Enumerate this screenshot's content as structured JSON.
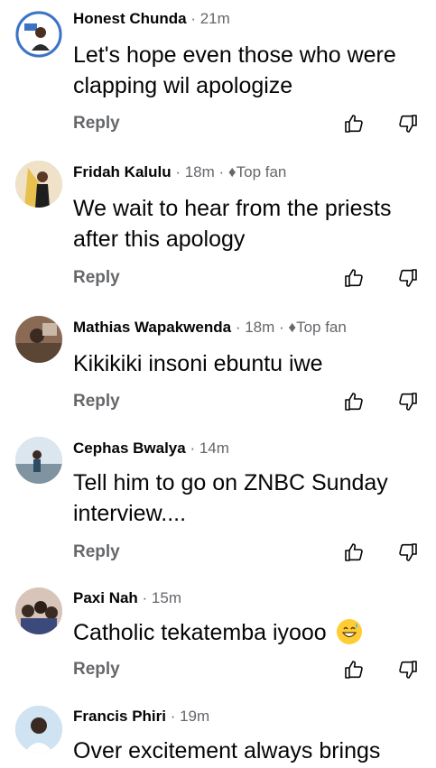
{
  "comments": [
    {
      "name": "Honest Chunda",
      "meta": " · 21m",
      "top_fan": "",
      "text": "Let's hope even those who were clapping wil apologize",
      "reply": "Reply",
      "avatar_color": "#3a73c6"
    },
    {
      "name": "Fridah Kalulu",
      "meta": " · 18m · ",
      "top_fan": "Top fan",
      "text": "We wait to hear from the priests after this apology",
      "reply": "Reply",
      "avatar_color": "#d9b45a"
    },
    {
      "name": "Mathias Wapakwenda",
      "meta": " · 18m · ",
      "top_fan": "Top fan",
      "text": "Kikikiki insoni ebuntu iwe",
      "reply": "Reply",
      "avatar_color": "#7a5b45"
    },
    {
      "name": "Cephas Bwalya",
      "meta": " · 14m",
      "top_fan": "",
      "text": "Tell him to go on ZNBC Sunday interview....",
      "reply": "Reply",
      "avatar_color": "#8fb0c8"
    },
    {
      "name": "Paxi Nah",
      "meta": " · 15m",
      "top_fan": "",
      "text": "Catholic tekatemba iyooo",
      "reply": "Reply",
      "avatar_color": "#5a4a6a"
    },
    {
      "name": "Francis Phiri",
      "meta": " · 19m",
      "top_fan": "",
      "text": "Over excitement always brings",
      "reply": "",
      "avatar_color": "#9ac0e0"
    }
  ],
  "icons": {
    "like": "thumbs-up-outline-icon",
    "dislike": "thumbs-down-outline-icon",
    "top_fan": "diamond-badge-icon",
    "emoji": "grinning-sweat-emoji"
  }
}
